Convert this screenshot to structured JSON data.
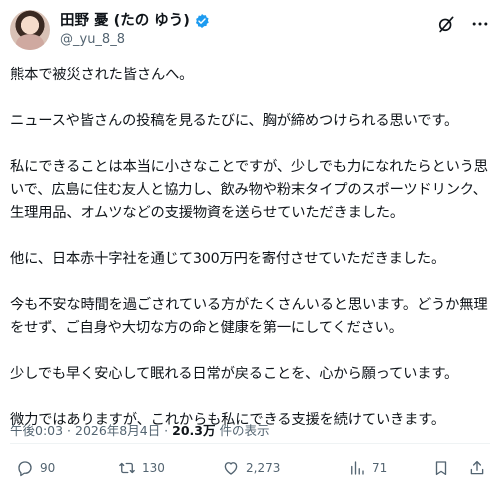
{
  "author": {
    "display_name": "田野 憂 (たの ゆう)",
    "handle": "@_yu_8_8"
  },
  "icons": {
    "verified": "verified-badge-icon",
    "grok": "grok-icon",
    "more": "more-icon",
    "reply": "reply-icon",
    "repost": "repost-icon",
    "like": "like-icon",
    "views": "views-icon",
    "bookmark": "bookmark-icon",
    "share": "share-icon"
  },
  "colors": {
    "verified": "#1d9bf0",
    "muted": "#536471",
    "text": "#0f1419"
  },
  "post": {
    "paragraphs": [
      "熊本で被災された皆さんへ。",
      "ニュースや皆さんの投稿を見るたびに、胸が締めつけられる思いです。",
      "私にできることは本当に小さなことですが、少しでも力になれたらという思いで、広島に住む友人と協力し、飲み物や粉末タイプのスポーツドリンク、生理用品、オムツなどの支援物資を送らせていただきました。",
      "他に、日本赤十字社を通じて300万円を寄付させていただきました。",
      "今も不安な時間を過ごされている方がたくさんいると思います。どうか無理をせず、ご自身や大切な方の命と健康を第一にしてください。",
      "少しでも早く安心して眠れる日常が戻ることを、心から願っています。",
      "微力ではありますが、これからも私にできる支援を続けていきます。"
    ],
    "timestamp": "午後0:03 · 2026年8月4日 · ",
    "views_count": "20.3万",
    "views_label": " 件の表示"
  },
  "stats": {
    "replies": "90",
    "reposts": "130",
    "likes": "2,273",
    "views": "71"
  }
}
